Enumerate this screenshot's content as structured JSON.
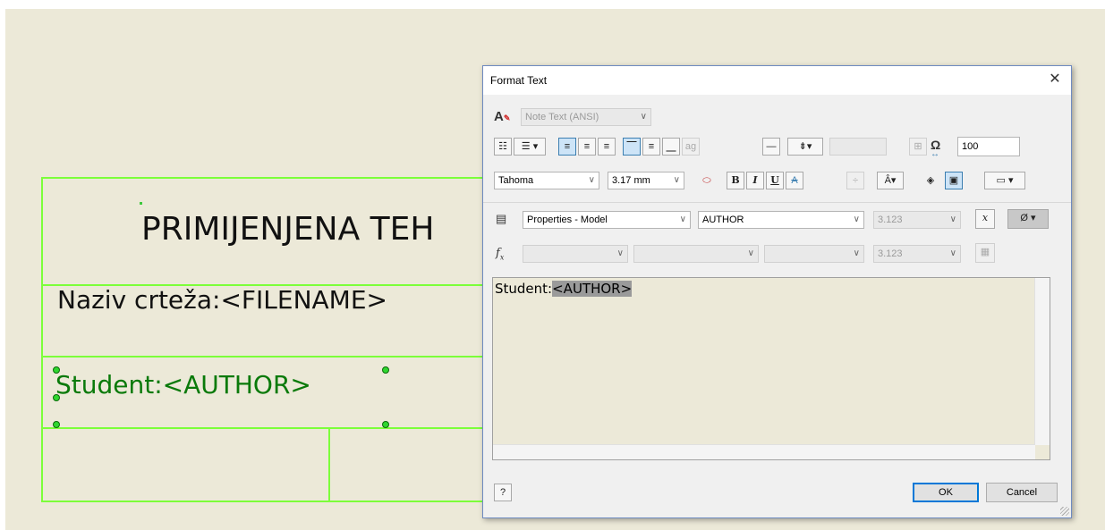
{
  "drawing": {
    "title_text": "PRIMIJENJENA TEH",
    "filename_text": "Naziv crteža:<FILENAME>",
    "author_text": "Student:<AUTHOR>"
  },
  "dialog": {
    "title": "Format Text",
    "style_combo": "Note Text (ANSI)",
    "font": "Tahoma",
    "font_size": "3.17 mm",
    "stretch_value": "100",
    "toolbar": {
      "bullets_icon": "☷",
      "numbering_icon": "☰",
      "numbering_dropdown": "▾",
      "align_left_icon": "≡",
      "align_center_icon": "≡",
      "align_right_icon": "≡",
      "valign_top_icon": "⎺",
      "valign_middle_icon": "≡",
      "valign_bottom_icon": "⎽",
      "ag_label": "ag",
      "bold": "B",
      "italic": "I",
      "underline": "U",
      "strike": "A",
      "omega": "Ω",
      "stretch_icon": "↔"
    },
    "parameter_source": "Properties - Model",
    "parameter_name": "AUTHOR",
    "precision": "3.123",
    "precision2": "3.123",
    "null_symbol": "Ø",
    "fx_label": "f",
    "fx_sub": "x",
    "editor_text": "Student:",
    "editor_tag": "<AUTHOR>",
    "ok_label": "OK",
    "cancel_label": "Cancel",
    "help_icon": "?"
  },
  "colors": {
    "canvas": "#ece9d8",
    "grid_line": "#7cff3a",
    "selected_text": "#0a7a0a"
  }
}
